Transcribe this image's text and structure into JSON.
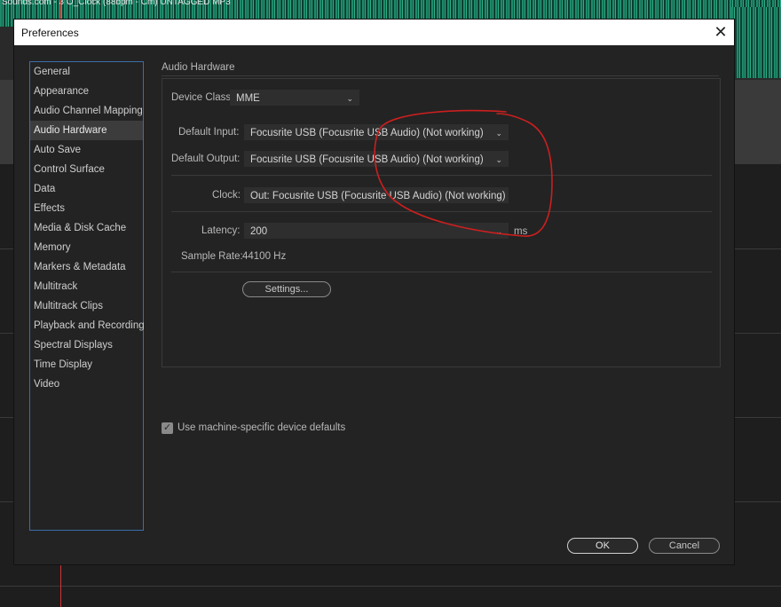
{
  "background": {
    "title_text": "Sounds.com - 3 O_Clock (88bpm - Cm) UNTAGGED MP3"
  },
  "dialog": {
    "title": "Preferences",
    "close_glyph": "✕"
  },
  "sidebar": {
    "items": [
      {
        "label": "General"
      },
      {
        "label": "Appearance"
      },
      {
        "label": "Audio Channel Mapping"
      },
      {
        "label": "Audio Hardware",
        "selected": true
      },
      {
        "label": "Auto Save"
      },
      {
        "label": "Control Surface"
      },
      {
        "label": "Data"
      },
      {
        "label": "Effects"
      },
      {
        "label": "Media & Disk Cache"
      },
      {
        "label": "Memory"
      },
      {
        "label": "Markers & Metadata"
      },
      {
        "label": "Multitrack"
      },
      {
        "label": "Multitrack Clips"
      },
      {
        "label": "Playback and Recording"
      },
      {
        "label": "Spectral Displays"
      },
      {
        "label": "Time Display"
      },
      {
        "label": "Video"
      }
    ]
  },
  "audio_hardware": {
    "section_title": "Audio Hardware",
    "device_class_label": "Device Class:",
    "device_class_value": "MME",
    "default_input_label": "Default Input:",
    "default_input_value": "Focusrite USB (Focusrite USB Audio) (Not working)",
    "default_output_label": "Default Output:",
    "default_output_value": "Focusrite USB (Focusrite USB Audio) (Not working)",
    "clock_label": "Clock:",
    "clock_value": "Out: Focusrite USB (Focusrite USB Audio) (Not working)",
    "latency_label": "Latency:",
    "latency_value": "200",
    "latency_unit": "ms",
    "sample_rate_label": "Sample Rate:",
    "sample_rate_value": "44100 Hz",
    "settings_button": "Settings..."
  },
  "machine_defaults": {
    "checked": true,
    "label": "Use machine-specific device defaults"
  },
  "footer": {
    "ok_label": "OK",
    "cancel_label": "Cancel"
  },
  "icons": {
    "dropdown_chevron": "chevron-down-icon",
    "checkbox_mark": "✓"
  },
  "colors": {
    "dialog_bg": "#232323",
    "sidebar_border": "#3b6ea8",
    "annotation_red": "#cc1f1f",
    "playhead_red": "#d13333"
  }
}
